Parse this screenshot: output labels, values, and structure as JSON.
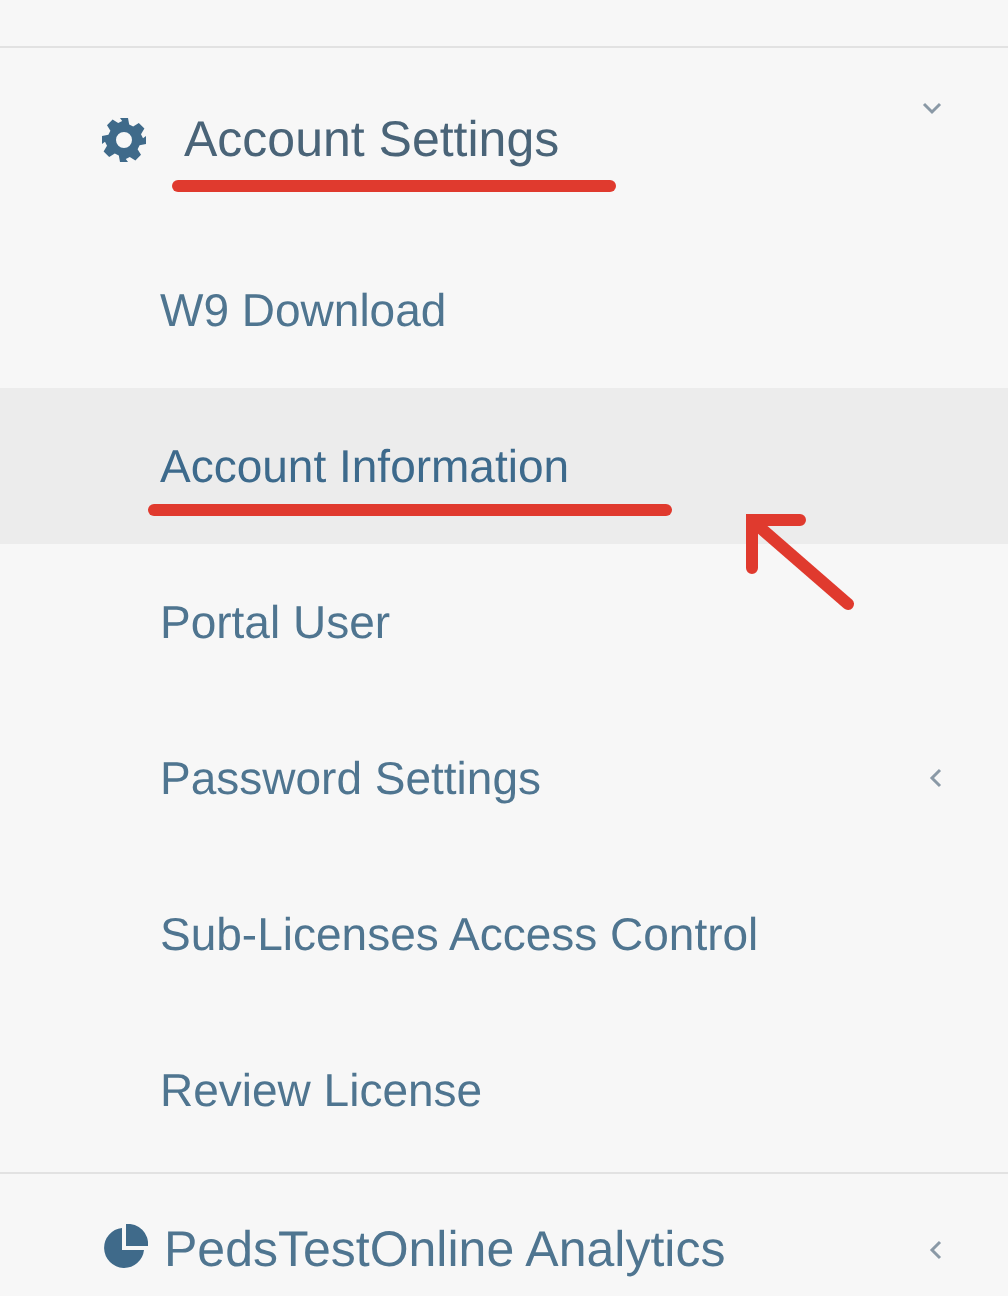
{
  "section": {
    "label": "Account Settings",
    "expanded": true,
    "underlined": true
  },
  "items": [
    {
      "label": "W9 Download",
      "selected": false,
      "underlined": false,
      "pointer": false,
      "has_submenu": false
    },
    {
      "label": "Account Information",
      "selected": true,
      "underlined": true,
      "pointer": true,
      "has_submenu": false
    },
    {
      "label": "Portal User",
      "selected": false,
      "underlined": false,
      "pointer": false,
      "has_submenu": false
    },
    {
      "label": "Password Settings",
      "selected": false,
      "underlined": false,
      "pointer": false,
      "has_submenu": true
    },
    {
      "label": "Sub-Licenses Access Control",
      "selected": false,
      "underlined": false,
      "pointer": false,
      "has_submenu": false
    },
    {
      "label": "Review License",
      "selected": false,
      "underlined": false,
      "pointer": false,
      "has_submenu": false
    }
  ],
  "next_section": {
    "label": "PedsTestOnline Analytics",
    "expanded": false
  }
}
